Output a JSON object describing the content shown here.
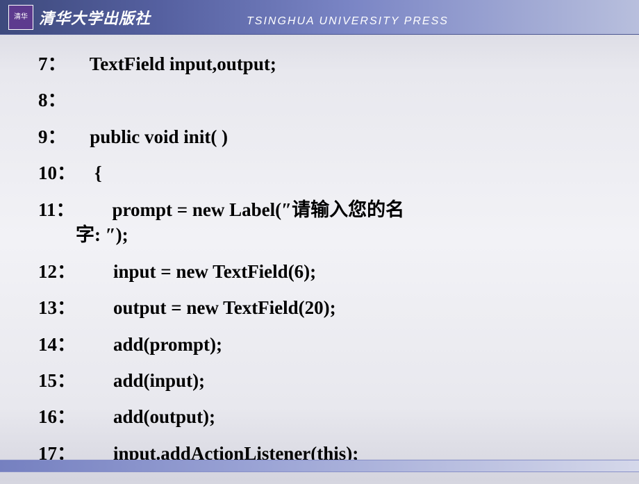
{
  "header": {
    "logo_inner": "清华",
    "title_cn": "清华大学出版社",
    "title_en": "TSINGHUA UNIVERSITY PRESS"
  },
  "code": {
    "lines": [
      {
        "num": "7：",
        "text": "     TextField input,output;"
      },
      {
        "num": "8：",
        "text": ""
      },
      {
        "num": "9：",
        "text": "     public void init( )"
      },
      {
        "num": "10：",
        "text": "    {"
      },
      {
        "num": "11：",
        "text": "        prompt = new Label(″请输入您的名",
        "cont": "        字: ″);"
      },
      {
        "num": "12：",
        "text": "        input = new TextField(6);"
      },
      {
        "num": "13：",
        "text": "        output = new TextField(20);"
      },
      {
        "num": "14：",
        "text": "        add(prompt);"
      },
      {
        "num": "15：",
        "text": "        add(input);"
      },
      {
        "num": "16：",
        "text": "        add(output);"
      },
      {
        "num": "17：",
        "text": "        input.addActionListener(this);"
      }
    ]
  }
}
